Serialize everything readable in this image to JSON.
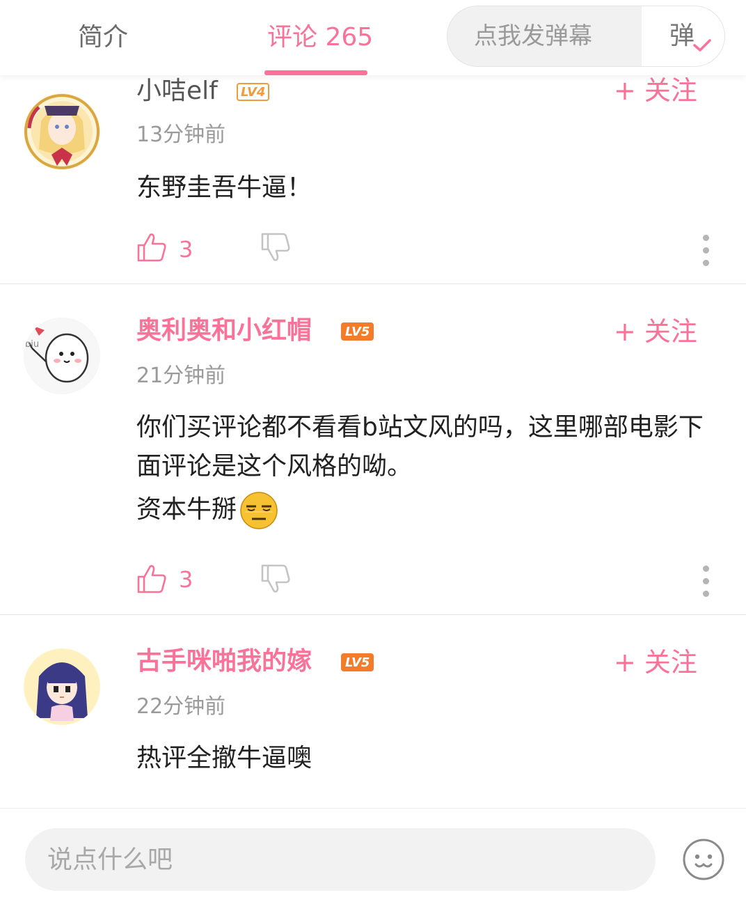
{
  "header": {
    "tab_intro": "简介",
    "tab_comments": "评论 265",
    "danmaku_placeholder": "点我发弹幕",
    "danmaku_toggle": "弹"
  },
  "comments": [
    {
      "username": "小咭elf",
      "level": "LV4",
      "follow": "+ 关注",
      "time": "13分钟前",
      "content": [
        "东野圭吾牛逼！"
      ],
      "likes": "3"
    },
    {
      "username": "奥利奥和小红帽",
      "level": "LV5",
      "follow": "+ 关注",
      "time": "21分钟前",
      "content": [
        "你们买评论都不看看b站文风的吗，这里哪部电影下面评论是这个风格的呦。",
        "资本牛掰"
      ],
      "likes": "3"
    },
    {
      "username": "古手咪啪我的嫁",
      "level": "LV5",
      "follow": "+ 关注",
      "time": "22分钟前",
      "content": [
        "热评全撤牛逼噢"
      ]
    }
  ],
  "footer": {
    "reply_placeholder": "说点什么吧"
  },
  "colors": {
    "accent": "#fb7299",
    "level_badge": "#f27c2a",
    "secondary_text": "#9a9a9a"
  },
  "icons": [
    "thumb-up-icon",
    "thumb-down-icon",
    "more-vertical-icon",
    "check-icon",
    "emoji-face-icon"
  ]
}
